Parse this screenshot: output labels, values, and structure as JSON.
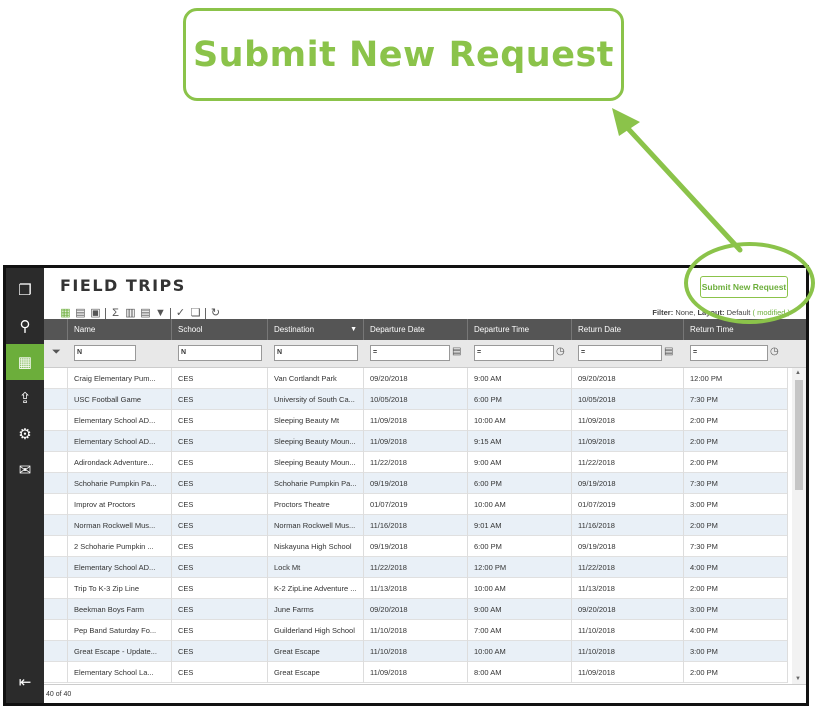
{
  "callout": {
    "label": "Submit New Request"
  },
  "colors": {
    "accent": "#8bc34a",
    "accent_dark": "#6cae3b",
    "sidebar_bg": "#2b2b2b",
    "header_bg": "#555555",
    "row_alt": "#e9f0f7"
  },
  "sidebar": {
    "items": [
      {
        "icon": "app-logo-icon",
        "glyph": "❐",
        "active": false
      },
      {
        "icon": "search-icon",
        "glyph": "⚲",
        "active": false
      },
      {
        "icon": "grid-view-icon",
        "glyph": "▦",
        "active": true
      },
      {
        "icon": "upload-icon",
        "glyph": "⇪",
        "active": false
      },
      {
        "icon": "settings-icon",
        "glyph": "⚙",
        "active": false
      },
      {
        "icon": "chat-icon",
        "glyph": "✉",
        "active": false
      },
      {
        "icon": "logout-icon",
        "glyph": "⇤",
        "active": false
      }
    ]
  },
  "header": {
    "title": "FIELD TRIPS",
    "submit_label": "Submit New Request"
  },
  "toolbar": {
    "filter_label": "Filter:",
    "filter_value": "None,",
    "layout_label": "Layout:",
    "layout_value": "Default",
    "layout_modified": "( modified )"
  },
  "columns": [
    "Name",
    "School",
    "Destination",
    "Departure Date",
    "Departure Time",
    "Return Date",
    "Return Time"
  ],
  "filters": {
    "name_op": "N",
    "school_op": "N",
    "destination_op": "N",
    "dep_date_op": "=",
    "dep_time_op": "=",
    "ret_date_op": "=",
    "ret_time_op": "="
  },
  "rows": [
    [
      "Craig Elementary Pum...",
      "CES",
      "Van Cortlandt Park",
      "09/20/2018",
      "9:00 AM",
      "09/20/2018",
      "12:00 PM"
    ],
    [
      "USC Football Game",
      "CES",
      "University of South Ca...",
      "10/05/2018",
      "6:00 PM",
      "10/05/2018",
      "7:30 PM"
    ],
    [
      "Elementary School AD...",
      "CES",
      "Sleeping Beauty Mt",
      "11/09/2018",
      "10:00 AM",
      "11/09/2018",
      "2:00 PM"
    ],
    [
      "Elementary School AD...",
      "CES",
      "Sleeping Beauty Moun...",
      "11/09/2018",
      "9:15 AM",
      "11/09/2018",
      "2:00 PM"
    ],
    [
      "Adirondack Adventure...",
      "CES",
      "Sleeping Beauty Moun...",
      "11/22/2018",
      "9:00 AM",
      "11/22/2018",
      "2:00 PM"
    ],
    [
      "Schoharie Pumpkin Pa...",
      "CES",
      "Schoharie Pumpkin Pa...",
      "09/19/2018",
      "6:00 PM",
      "09/19/2018",
      "7:30 PM"
    ],
    [
      "Improv at Proctors",
      "CES",
      "Proctors Theatre",
      "01/07/2019",
      "10:00 AM",
      "01/07/2019",
      "3:00 PM"
    ],
    [
      "Norman Rockwell Mus...",
      "CES",
      "Norman Rockwell Mus...",
      "11/16/2018",
      "9:01 AM",
      "11/16/2018",
      "2:00 PM"
    ],
    [
      "2 Schoharie Pumpkin ...",
      "CES",
      "Niskayuna High School",
      "09/19/2018",
      "6:00 PM",
      "09/19/2018",
      "7:30 PM"
    ],
    [
      "Elementary School AD...",
      "CES",
      "Lock Mt",
      "11/22/2018",
      "12:00 PM",
      "11/22/2018",
      "4:00 PM"
    ],
    [
      "Trip To K-3 Zip Line",
      "CES",
      "K-2 ZipLine Adventure ...",
      "11/13/2018",
      "10:00 AM",
      "11/13/2018",
      "2:00 PM"
    ],
    [
      "Beekman Boys Farm",
      "CES",
      "June Farms",
      "09/20/2018",
      "9:00 AM",
      "09/20/2018",
      "3:00 PM"
    ],
    [
      "Pep Band Saturday Fo...",
      "CES",
      "Guilderland High School",
      "11/10/2018",
      "7:00 AM",
      "11/10/2018",
      "4:00 PM"
    ],
    [
      "Great Escape - Update...",
      "CES",
      "Great Escape",
      "11/10/2018",
      "10:00 AM",
      "11/10/2018",
      "3:00 PM"
    ],
    [
      "Elementary School La...",
      "CES",
      "Great Escape",
      "11/09/2018",
      "8:00 AM",
      "11/09/2018",
      "2:00 PM"
    ]
  ],
  "footer": {
    "count": "40 of 40"
  }
}
